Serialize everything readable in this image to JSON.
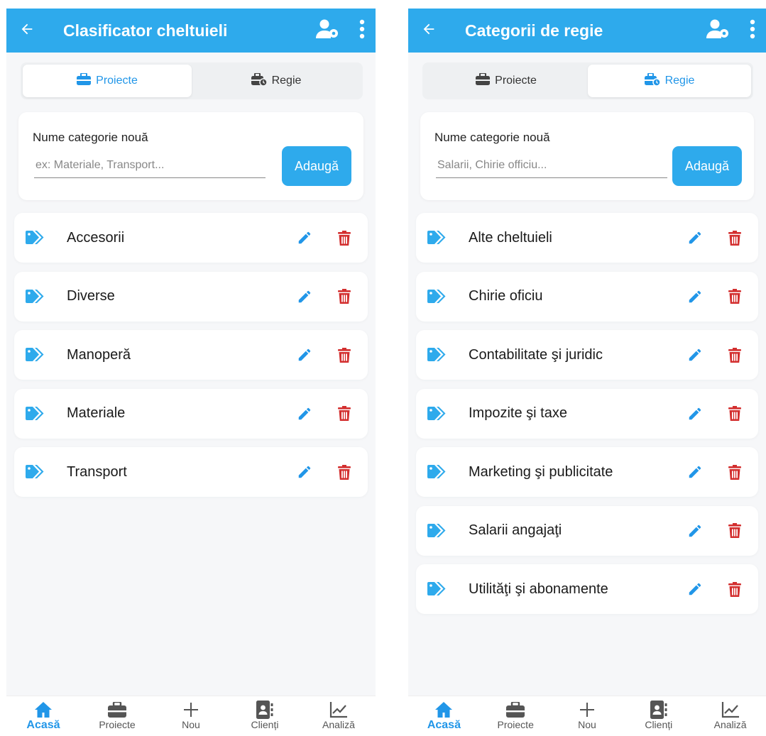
{
  "colors": {
    "primary": "#2eaaec",
    "accent_text": "#2196e8",
    "danger": "#d32f2f",
    "background": "#f6f7f9"
  },
  "screens": [
    {
      "appbar": {
        "title": "Clasificator cheltuieli",
        "back_icon": "arrow-left-icon",
        "settings_icon": "user-gear-icon",
        "more_icon": "dots-vertical-icon"
      },
      "tabs": [
        {
          "label": "Proiecte",
          "icon": "briefcase-icon",
          "active": true
        },
        {
          "label": "Regie",
          "icon": "briefcase-clock-icon",
          "active": false
        }
      ],
      "form": {
        "label": "Nume categorie nouă",
        "placeholder": "ex: Materiale, Transport...",
        "value": "",
        "button": "Adaugă"
      },
      "categories": [
        "Accesorii",
        "Diverse",
        "Manoperă",
        "Materiale",
        "Transport"
      ],
      "nav": [
        {
          "label": "Acasă",
          "icon": "home-icon",
          "active": true
        },
        {
          "label": "Proiecte",
          "icon": "briefcase-icon",
          "active": false
        },
        {
          "label": "Nou",
          "icon": "plus-icon",
          "active": false
        },
        {
          "label": "Clienți",
          "icon": "contacts-icon",
          "active": false
        },
        {
          "label": "Analiză",
          "icon": "chart-line-icon",
          "active": false
        }
      ]
    },
    {
      "appbar": {
        "title": "Categorii de regie",
        "back_icon": "arrow-left-icon",
        "settings_icon": "user-gear-icon",
        "more_icon": "dots-vertical-icon"
      },
      "tabs": [
        {
          "label": "Proiecte",
          "icon": "briefcase-icon",
          "active": false
        },
        {
          "label": "Regie",
          "icon": "briefcase-clock-icon",
          "active": true
        }
      ],
      "form": {
        "label": "Nume categorie nouă",
        "placeholder": "Salarii, Chirie officiu...",
        "value": "",
        "button": "Adaugă"
      },
      "categories": [
        "Alte cheltuieli",
        "Chirie oficiu",
        "Contabilitate şi juridic",
        "Impozite şi taxe",
        "Marketing şi publicitate",
        "Salarii angajaţi",
        "Utilităţi şi abonamente"
      ],
      "nav": [
        {
          "label": "Acasă",
          "icon": "home-icon",
          "active": true
        },
        {
          "label": "Proiecte",
          "icon": "briefcase-icon",
          "active": false
        },
        {
          "label": "Nou",
          "icon": "plus-icon",
          "active": false
        },
        {
          "label": "Clienți",
          "icon": "contacts-icon",
          "active": false
        },
        {
          "label": "Analiză",
          "icon": "chart-line-icon",
          "active": false
        }
      ]
    }
  ]
}
